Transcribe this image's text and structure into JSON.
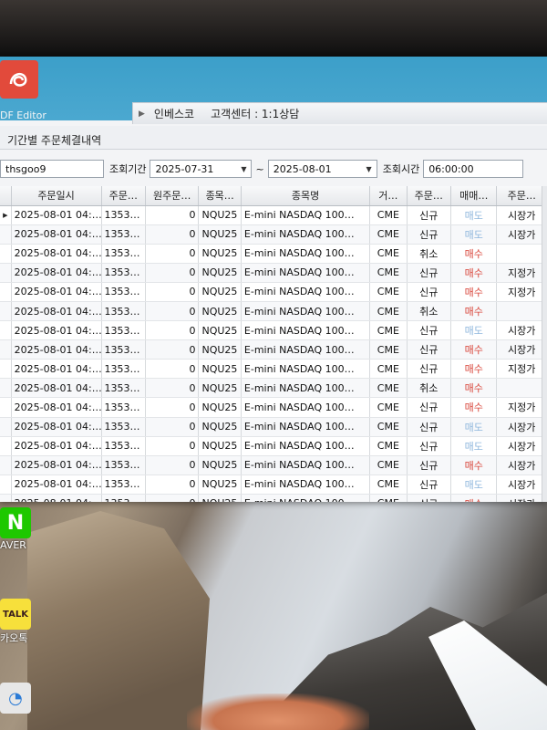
{
  "toolbar": {
    "pdf_editor_label": "DF Editor",
    "menu_item_1": "인베스코",
    "menu_item_2": "고객센터 : 1:1상담"
  },
  "window": {
    "title": "기간별 주문체결내역"
  },
  "filter": {
    "account_value": "thsgoo9",
    "period_label": "조회기간",
    "start_date": "2025-07-31",
    "tilde": "~",
    "end_date": "2025-08-01",
    "time_label": "조회시간",
    "time_value": "06:00:00"
  },
  "grid": {
    "columns": [
      "주문일시",
      "주문…",
      "원주문…",
      "종목…",
      "종목명",
      "거…",
      "주문…",
      "매매…",
      "주문…"
    ],
    "rows": [
      {
        "date": "2025-08-01 04:…",
        "order_no": "1353…",
        "orig_no": "0",
        "code": "NQU25",
        "name": "E-mini NASDAQ 100…",
        "exchange": "CME",
        "order_type": "신규",
        "side": "매도",
        "price_type": "시장가"
      },
      {
        "date": "2025-08-01 04:…",
        "order_no": "1353…",
        "orig_no": "0",
        "code": "NQU25",
        "name": "E-mini NASDAQ 100…",
        "exchange": "CME",
        "order_type": "신규",
        "side": "매도",
        "price_type": "시장가"
      },
      {
        "date": "2025-08-01 04:…",
        "order_no": "1353…",
        "orig_no": "0",
        "code": "NQU25",
        "name": "E-mini NASDAQ 100…",
        "exchange": "CME",
        "order_type": "취소",
        "side": "매수",
        "price_type": ""
      },
      {
        "date": "2025-08-01 04:…",
        "order_no": "1353…",
        "orig_no": "0",
        "code": "NQU25",
        "name": "E-mini NASDAQ 100…",
        "exchange": "CME",
        "order_type": "신규",
        "side": "매수",
        "price_type": "지정가"
      },
      {
        "date": "2025-08-01 04:…",
        "order_no": "1353…",
        "orig_no": "0",
        "code": "NQU25",
        "name": "E-mini NASDAQ 100…",
        "exchange": "CME",
        "order_type": "신규",
        "side": "매수",
        "price_type": "지정가"
      },
      {
        "date": "2025-08-01 04:…",
        "order_no": "1353…",
        "orig_no": "0",
        "code": "NQU25",
        "name": "E-mini NASDAQ 100…",
        "exchange": "CME",
        "order_type": "취소",
        "side": "매수",
        "price_type": ""
      },
      {
        "date": "2025-08-01 04:…",
        "order_no": "1353…",
        "orig_no": "0",
        "code": "NQU25",
        "name": "E-mini NASDAQ 100…",
        "exchange": "CME",
        "order_type": "신규",
        "side": "매도",
        "price_type": "시장가"
      },
      {
        "date": "2025-08-01 04:…",
        "order_no": "1353…",
        "orig_no": "0",
        "code": "NQU25",
        "name": "E-mini NASDAQ 100…",
        "exchange": "CME",
        "order_type": "신규",
        "side": "매수",
        "price_type": "시장가"
      },
      {
        "date": "2025-08-01 04:…",
        "order_no": "1353…",
        "orig_no": "0",
        "code": "NQU25",
        "name": "E-mini NASDAQ 100…",
        "exchange": "CME",
        "order_type": "신규",
        "side": "매수",
        "price_type": "지정가"
      },
      {
        "date": "2025-08-01 04:…",
        "order_no": "1353…",
        "orig_no": "0",
        "code": "NQU25",
        "name": "E-mini NASDAQ 100…",
        "exchange": "CME",
        "order_type": "취소",
        "side": "매수",
        "price_type": ""
      },
      {
        "date": "2025-08-01 04:…",
        "order_no": "1353…",
        "orig_no": "0",
        "code": "NQU25",
        "name": "E-mini NASDAQ 100…",
        "exchange": "CME",
        "order_type": "신규",
        "side": "매수",
        "price_type": "지정가"
      },
      {
        "date": "2025-08-01 04:…",
        "order_no": "1353…",
        "orig_no": "0",
        "code": "NQU25",
        "name": "E-mini NASDAQ 100…",
        "exchange": "CME",
        "order_type": "신규",
        "side": "매도",
        "price_type": "시장가"
      },
      {
        "date": "2025-08-01 04:…",
        "order_no": "1353…",
        "orig_no": "0",
        "code": "NQU25",
        "name": "E-mini NASDAQ 100…",
        "exchange": "CME",
        "order_type": "신규",
        "side": "매도",
        "price_type": "시장가"
      },
      {
        "date": "2025-08-01 04:…",
        "order_no": "1353…",
        "orig_no": "0",
        "code": "NQU25",
        "name": "E-mini NASDAQ 100…",
        "exchange": "CME",
        "order_type": "신규",
        "side": "매수",
        "price_type": "시장가"
      },
      {
        "date": "2025-08-01 04:…",
        "order_no": "1353…",
        "orig_no": "0",
        "code": "NQU25",
        "name": "E-mini NASDAQ 100…",
        "exchange": "CME",
        "order_type": "신규",
        "side": "매도",
        "price_type": "시장가"
      },
      {
        "date": "2025-08-01 04:…",
        "order_no": "1353…",
        "orig_no": "0",
        "code": "NQU25",
        "name": "E-mini NASDAQ 100…",
        "exchange": "CME",
        "order_type": "신규",
        "side": "매수",
        "price_type": "시장가"
      }
    ]
  },
  "desktop": {
    "icon_1_label": "AVER",
    "icon_2_tile": "TALK",
    "icon_2_label": "카오톡"
  },
  "colors": {
    "buy": "#d9453a",
    "sell": "#8fb7dd",
    "toolbar_blue": "#3c9fc9"
  }
}
